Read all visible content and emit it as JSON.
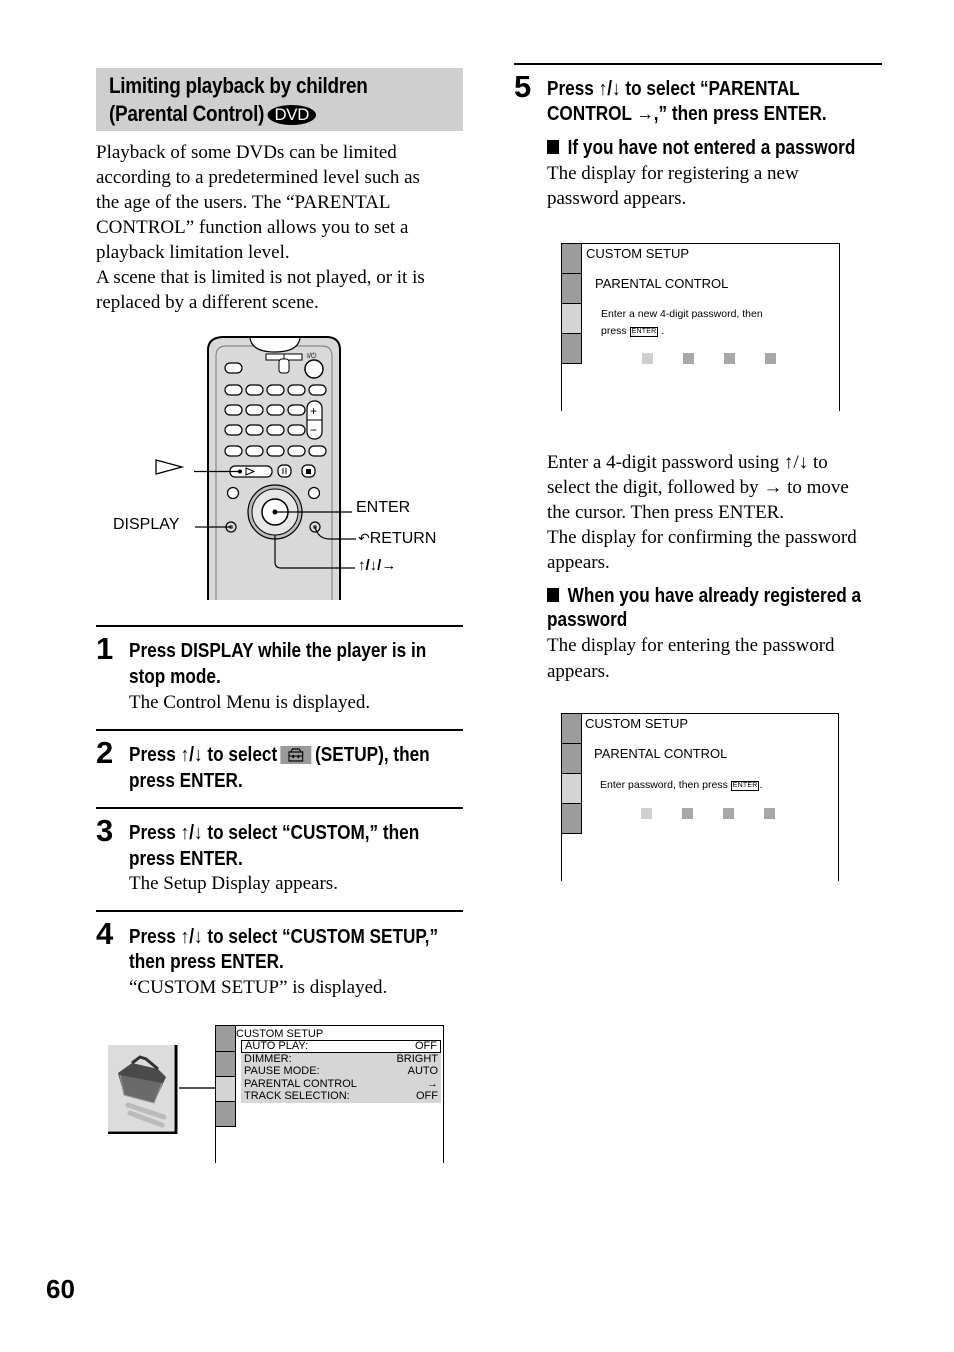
{
  "section": {
    "title_line1": "Limiting playback by children",
    "title_line2": "(Parental Control)",
    "badge": "DVD"
  },
  "intro": {
    "lines": [
      "Playback of some DVDs can be limited",
      "according to a predetermined level such as",
      "the age of the users. The “PARENTAL",
      "CONTROL” function allows you to set a",
      "playback limitation level.",
      "A scene that is limited is not played, or it is",
      "replaced by a different scene."
    ]
  },
  "remote": {
    "labels": {
      "play": "▷",
      "display": "DISPLAY",
      "enter": "ENTER",
      "return": "RETURN",
      "arrows": "↑/↓/→"
    }
  },
  "steps": [
    {
      "number": "1",
      "title_lines": [
        "Press DISPLAY while the player is in",
        "stop mode."
      ],
      "desc": "The Control Menu is displayed."
    },
    {
      "number": "2",
      "title_pre": "Press ↑/↓ to select",
      "title_post": "(SETUP), then",
      "title_line2": "press ENTER.",
      "icon": "toolbox-icon"
    },
    {
      "number": "3",
      "title_lines": [
        "Press ↑/↓ to select “CUSTOM,” then",
        "press ENTER."
      ],
      "desc": "The Setup Display appears."
    },
    {
      "number": "4",
      "title_lines": [
        "Press ↑/↓ to select “CUSTOM SETUP,”",
        "then press ENTER."
      ],
      "desc": "“CUSTOM SETUP” is displayed."
    },
    {
      "number": "5",
      "title_lines": [
        "Press ↑/↓ to select “PARENTAL",
        "CONTROL →,” then press ENTER."
      ]
    }
  ],
  "custom_setup_screen": {
    "title": "CUSTOM SETUP",
    "items": [
      {
        "label": "AUTO PLAY:",
        "value": "OFF",
        "selected": true
      },
      {
        "label": "DIMMER:",
        "value": "BRIGHT",
        "selected": false
      },
      {
        "label": "PAUSE MODE:",
        "value": "AUTO",
        "selected": false
      },
      {
        "label": "PARENTAL CONTROL",
        "value": "→",
        "selected": false
      },
      {
        "label": "TRACK SELECTION:",
        "value": "OFF",
        "selected": false
      }
    ]
  },
  "not_entered": {
    "heading": "If you have not entered a password",
    "desc_lines": [
      "The display for registering a new",
      "password appears."
    ],
    "screen": {
      "title": "CUSTOM SETUP",
      "subtitle": "PARENTAL CONTROL",
      "prompt_line1": "Enter a new 4-digit password, then",
      "prompt_line2_pre": "press",
      "prompt_key": "ENTER",
      "prompt_line2_post": "."
    }
  },
  "enter_instructions": {
    "lines": [
      "Enter a 4-digit password using ↑/↓ to",
      "select the digit, followed by → to move",
      "the cursor. Then press ENTER.",
      "The display for confirming the password",
      "appears."
    ]
  },
  "already_registered": {
    "heading_line1": "When you have already registered a",
    "heading_line2": "password",
    "desc_lines": [
      "The display for entering the password",
      "appears."
    ],
    "screen": {
      "title": "CUSTOM SETUP",
      "subtitle": "PARENTAL CONTROL",
      "prompt_pre": "Enter password, then press",
      "prompt_key": "ENTER",
      "prompt_post": "."
    }
  },
  "page_number": "60"
}
